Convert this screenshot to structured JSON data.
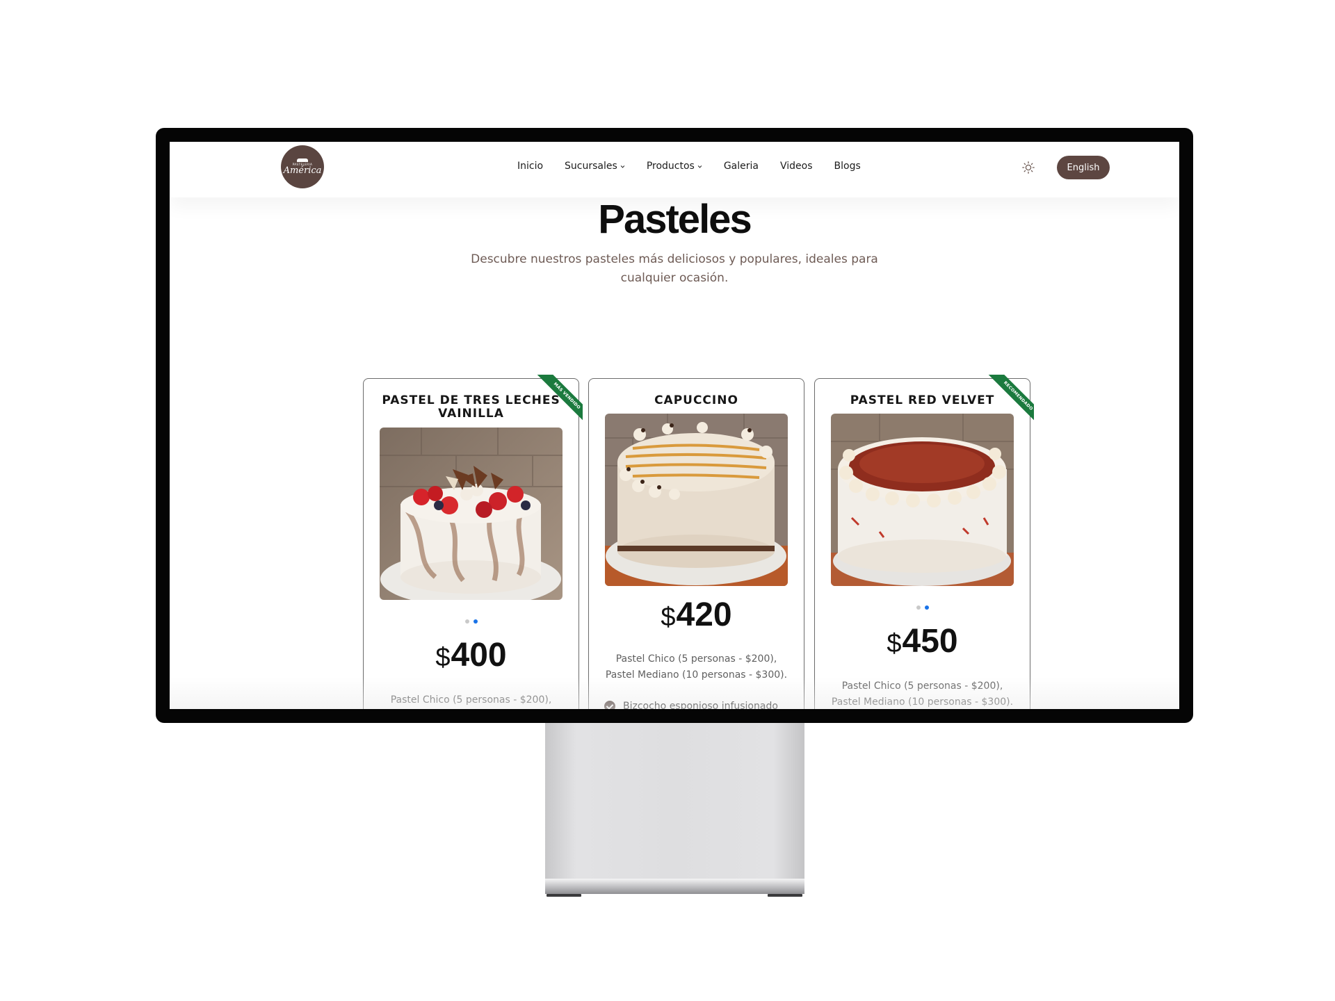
{
  "header": {
    "logo_small": "PASTELERIA",
    "logo_name": "América",
    "nav": [
      {
        "label": "Inicio",
        "dropdown": false
      },
      {
        "label": "Sucursales",
        "dropdown": true
      },
      {
        "label": "Productos",
        "dropdown": true
      },
      {
        "label": "Galeria",
        "dropdown": false
      },
      {
        "label": "Videos",
        "dropdown": false
      },
      {
        "label": "Blogs",
        "dropdown": false
      }
    ],
    "theme_icon": "sun-icon",
    "language_button": "English"
  },
  "section": {
    "title": "Pasteles",
    "subtitle": "Descubre nuestros pasteles más deliciosos y populares, ideales para cualquier ocasión."
  },
  "products": [
    {
      "title": "PASTEL DE TRES LECHES VAINILLA",
      "badge": "MÁS VENDIDO",
      "currency": "$",
      "price": "400",
      "desc": "Pastel Chico (5 personas - $200),",
      "slides": 2,
      "active_slide": 2
    },
    {
      "title": "CAPUCCINO",
      "currency": "$",
      "price": "420",
      "desc_1": "Pastel Chico (5 personas - $200),",
      "desc_2": "Pastel Mediano (10 personas - $300).",
      "feature": "Bizcocho esponjoso infusionado"
    },
    {
      "title": "PASTEL RED VELVET",
      "badge": "RECOMENDADO",
      "currency": "$",
      "price": "450",
      "desc_1": "Pastel Chico (5 personas - $200),",
      "desc_2": "Pastel Mediano (10 personas - $300).",
      "slides": 2,
      "active_slide": 2
    }
  ],
  "colors": {
    "brand": "#5d4641",
    "badge_green": "#1b7a3e",
    "dot_active": "#1a73e8"
  }
}
